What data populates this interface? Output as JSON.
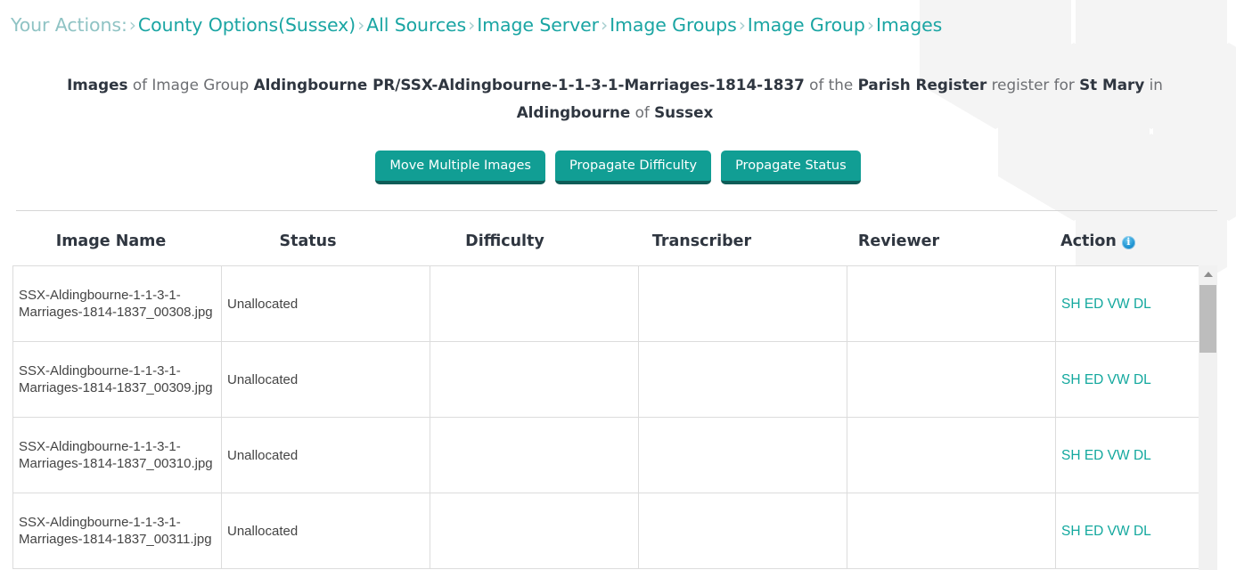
{
  "breadcrumb": {
    "label": "Your Actions:",
    "separator": "›",
    "items": [
      {
        "label": "County Options(Sussex)"
      },
      {
        "label": "All Sources"
      },
      {
        "label": "Image Server"
      },
      {
        "label": "Image Groups"
      },
      {
        "label": "Image Group"
      },
      {
        "label": "Images"
      }
    ]
  },
  "heading": {
    "p1_bold": "Images",
    "p2": " of Image Group ",
    "p3_bold": "Aldingbourne PR/SSX-Aldingbourne-1-1-3-1-Marriages-1814-1837",
    "p4": " of the ",
    "p5_bold": "Parish Register",
    "p6": " register for ",
    "p7_bold": "St Mary",
    "p8": " in ",
    "p9_bold": "Aldingbourne",
    "p10": " of ",
    "p11_bold": "Sussex"
  },
  "buttons": [
    {
      "label": "Move Multiple Images"
    },
    {
      "label": "Propagate Difficulty"
    },
    {
      "label": "Propagate Status"
    }
  ],
  "table": {
    "columns": [
      {
        "label": "Image Name"
      },
      {
        "label": "Status"
      },
      {
        "label": "Difficulty"
      },
      {
        "label": "Transcriber"
      },
      {
        "label": "Reviewer"
      },
      {
        "label": "Action",
        "icon": "info-icon"
      }
    ],
    "rows": [
      {
        "name": "SSX-Aldingbourne-1-1-3-1-Marriages-1814-1837_00308.jpg",
        "status": "Unallocated",
        "difficulty": "",
        "transcriber": "",
        "reviewer": "",
        "actions": "SH ED VW DL"
      },
      {
        "name": "SSX-Aldingbourne-1-1-3-1-Marriages-1814-1837_00309.jpg",
        "status": "Unallocated",
        "difficulty": "",
        "transcriber": "",
        "reviewer": "",
        "actions": "SH ED VW DL"
      },
      {
        "name": "SSX-Aldingbourne-1-1-3-1-Marriages-1814-1837_00310.jpg",
        "status": "Unallocated",
        "difficulty": "",
        "transcriber": "",
        "reviewer": "",
        "actions": "SH ED VW DL"
      },
      {
        "name": "SSX-Aldingbourne-1-1-3-1-Marriages-1814-1837_00311.jpg",
        "status": "Unallocated",
        "difficulty": "",
        "transcriber": "",
        "reviewer": "",
        "actions": "SH ED VW DL"
      }
    ]
  },
  "colors": {
    "brand_teal": "#119e94",
    "brand_teal_dark": "#0e5d58",
    "link_teal": "#13a89e",
    "breadcrumb_label": "#8fc3c4",
    "heading_dark": "#2f3640",
    "heading_muted": "#6d6f73",
    "info_blue": "#2196d4",
    "hex_watermark": "#f4f4f4",
    "cell_border": "#dcdcdc"
  }
}
